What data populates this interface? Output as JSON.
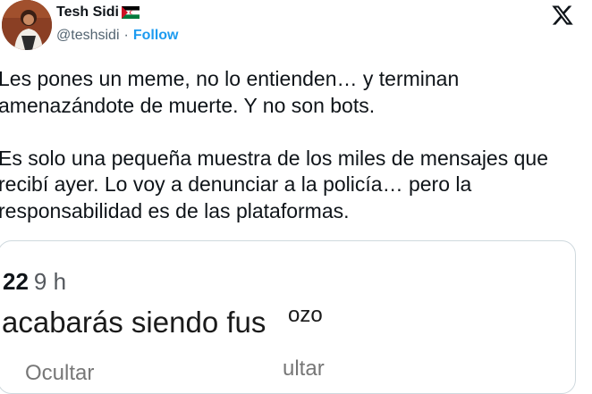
{
  "author": {
    "display_name": "Tesh Sidi",
    "handle": "@teshsidi",
    "separator": "·",
    "follow_label": "Follow",
    "flag_icon": "western-sahara-flag-icon",
    "avatar_icon": "profile-avatar"
  },
  "platform": {
    "logo_icon": "x-logo-icon"
  },
  "tweet": {
    "paragraph_1": "Les pones un meme, no lo entienden… y terminan amenazándote de muerte. Y no son bots.",
    "paragraph_2": "Es solo una pequeña muestra de los miles de mensajes que recibí ayer. Lo voy a denunciar a la policía… pero la responsabilidad es de las plataformas."
  },
  "media": {
    "count": "22",
    "time_ago": "9 h",
    "message": "acabarás siendo fus",
    "overlay_text": "ozo",
    "bottom_left": "Ocultar",
    "bottom_right": "ultar"
  },
  "colors": {
    "link": "#1d9bf0",
    "secondary_text": "#536471",
    "border": "#cfd9de"
  }
}
